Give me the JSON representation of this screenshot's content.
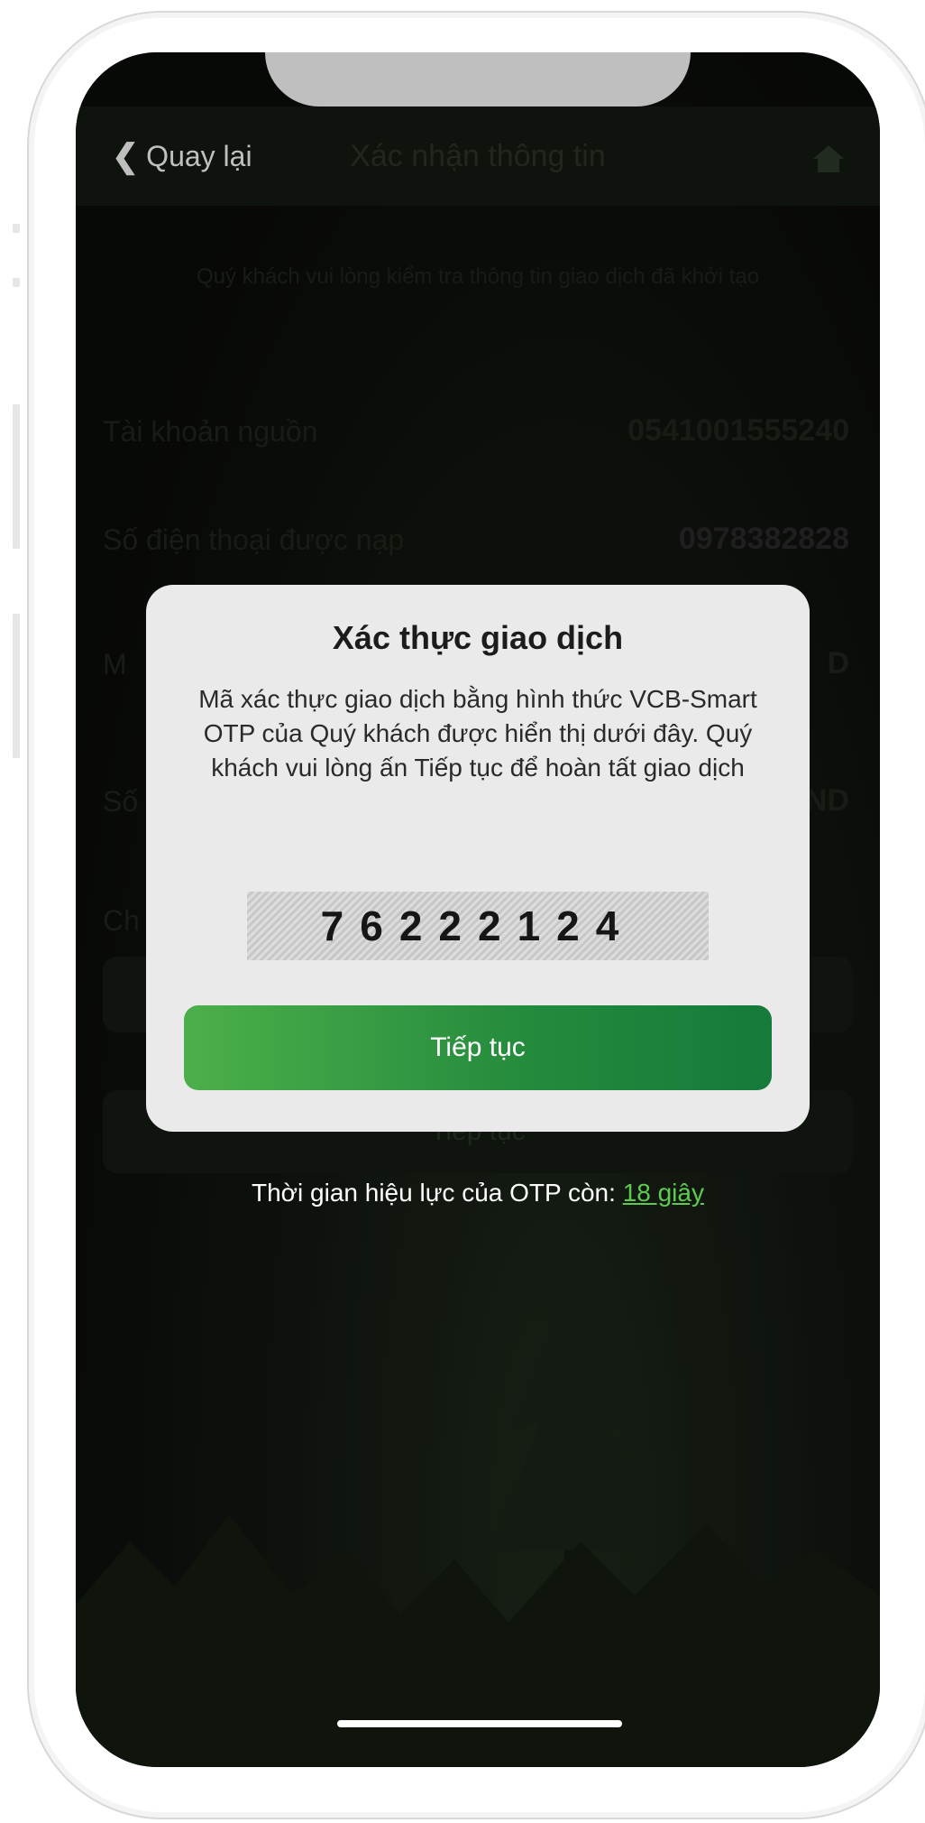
{
  "nav": {
    "back_label": "Quay lại",
    "title": "Xác nhận thông tin",
    "home_icon": "home-icon"
  },
  "background": {
    "intro": "Quý khách vui lòng kiểm tra thông tin giao dịch đã khởi tạo",
    "rows": [
      {
        "label": "Tài khoản nguồn",
        "value": "0541001555240"
      },
      {
        "label": "Số điện thoại được nạp",
        "value": "0978382828"
      },
      {
        "label": "M",
        "value": "D"
      },
      {
        "label": "Số",
        "value": "ND"
      },
      {
        "label": "Ch",
        "value": ""
      }
    ],
    "continue_label": "Tiếp tục"
  },
  "dialog": {
    "title": "Xác thực giao dịch",
    "message": "Mã xác thực giao dịch bằng hình thức VCB-Smart OTP của Quý khách được hiển thị dưới đây. Quý khách vui lòng ấn Tiếp tục để hoàn tất giao dịch",
    "otp_code": "76222124",
    "continue_label": "Tiếp tục"
  },
  "expiry": {
    "prefix": "Thời gian hiệu lực của OTP còn: ",
    "remaining": "18 giây"
  },
  "colors": {
    "accent_green": "#238a3d",
    "link_green": "#5ecb4f",
    "dialog_bg": "#eaeaea"
  }
}
